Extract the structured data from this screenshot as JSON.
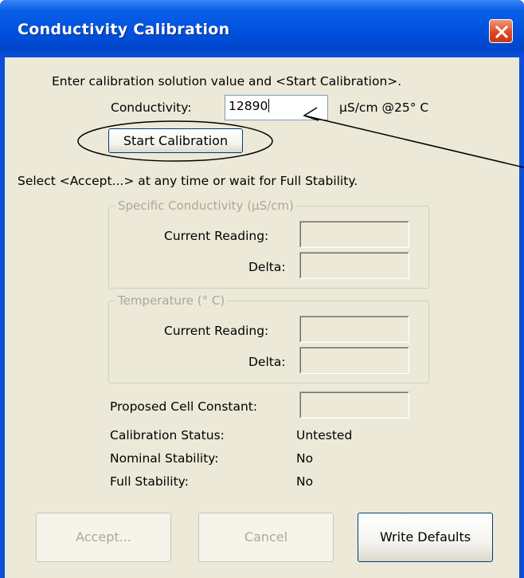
{
  "window": {
    "title": "Conductivity Calibration"
  },
  "instructions": {
    "line1": "Enter calibration solution value and <Start Calibration>.",
    "line2": "Select <Accept...> at any time or wait for Full Stability."
  },
  "conductivity": {
    "label": "Conductivity:",
    "value": "12890",
    "unit": "µS/cm @25° C"
  },
  "start_button": {
    "label": "Start Calibration"
  },
  "specific_group": {
    "title": "Specific Conductivity  (µS/cm)",
    "current_label": "Current Reading:",
    "delta_label": "Delta:"
  },
  "temperature_group": {
    "title": "Temperature (° C)",
    "current_label": "Current Reading:",
    "delta_label": "Delta:"
  },
  "proposed": {
    "label": "Proposed Cell Constant:"
  },
  "status": {
    "calibration_label": "Calibration Status:",
    "calibration_value": "Untested",
    "nominal_label": "Nominal Stability:",
    "nominal_value": "No",
    "full_label": "Full Stability:",
    "full_value": "No"
  },
  "buttons": {
    "accept": "Accept...",
    "cancel": "Cancel",
    "write_defaults": "Write Defaults"
  },
  "colors": {
    "title_bar": "#0a4fd8",
    "dialog_bg": "#ece9d8",
    "close_button": "#d9461d",
    "annotation": "#000000"
  }
}
